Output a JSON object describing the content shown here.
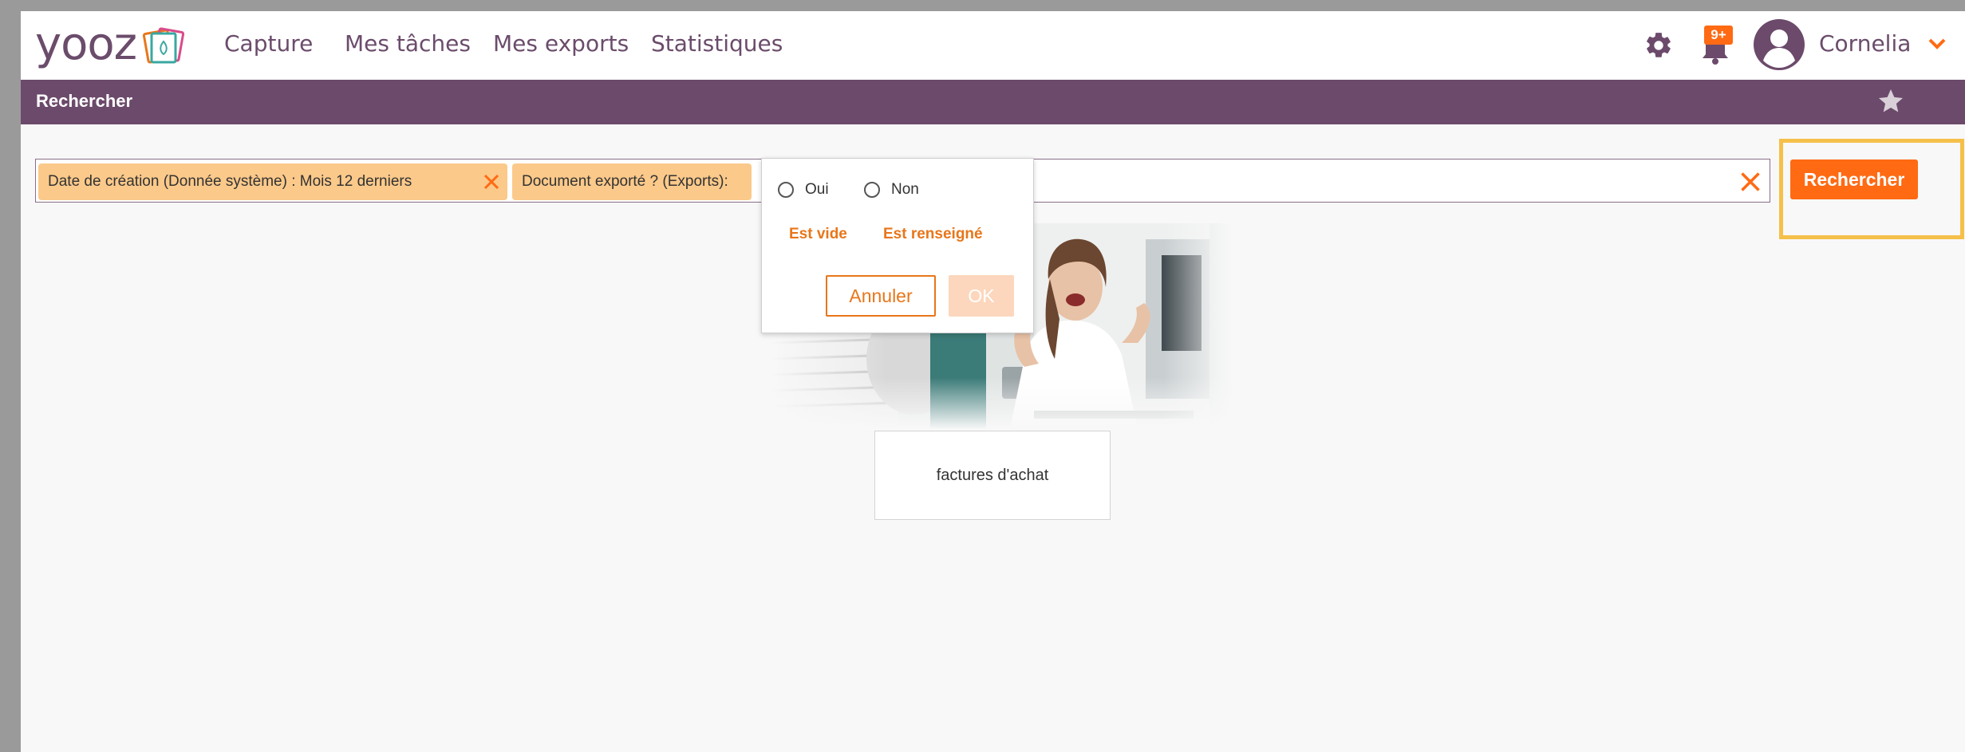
{
  "logo": {
    "text": "yooz",
    "icon": "yooz-cards-icon"
  },
  "nav": {
    "links": [
      "Capture",
      "Mes tâches",
      "Mes exports",
      "Statistiques"
    ],
    "settings_icon": "gear-icon",
    "notifications": {
      "icon": "bell-icon",
      "badge": "9+"
    },
    "user": {
      "icon": "user-avatar-icon",
      "name": "Cornelia",
      "chevron": "chevron-down-icon"
    }
  },
  "subbar": {
    "title": "Rechercher",
    "favorite_icon": "star-icon"
  },
  "search": {
    "chips": [
      {
        "label": "Date de création (Donnée système) : Mois 12 derniers"
      },
      {
        "label": "Document exporté ? (Exports):"
      }
    ],
    "clear_icon": "close-icon",
    "button_label": "Rechercher"
  },
  "dropdown": {
    "options": [
      "Oui",
      "Non"
    ],
    "links": [
      "Est vide",
      "Est renseigné"
    ],
    "cancel_label": "Annuler",
    "ok_label": "OK"
  },
  "card": {
    "label": "factures d'achat"
  },
  "colors": {
    "brand_purple": "#6c4a6b",
    "accent_orange": "#ff6a13",
    "chip_bg": "#fbc98a",
    "highlight": "#f5c04a"
  }
}
